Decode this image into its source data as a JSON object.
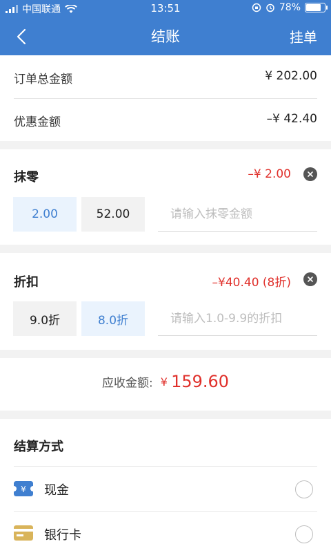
{
  "status_bar": {
    "carrier": "中国联通",
    "time": "13:51",
    "battery": "78%",
    "battery_level": 0.78
  },
  "nav": {
    "title": "结账",
    "action": "挂单"
  },
  "summary": {
    "total_label": "订单总金额",
    "total_value": "¥ 202.00",
    "discount_label": "优惠金额",
    "discount_value": "–¥ 42.40"
  },
  "rounding": {
    "title": "抹零",
    "value": "–¥ 2.00",
    "options": [
      "2.00",
      "52.00"
    ],
    "selected": 0,
    "placeholder": "请输入抹零金额"
  },
  "discount": {
    "title": "折扣",
    "value": "–¥40.40 (8折)",
    "options": [
      "9.0折",
      "8.0折"
    ],
    "selected": 1,
    "placeholder": "请输入1.0-9.9的折扣"
  },
  "receivable": {
    "label": "应收金额:",
    "currency": "¥",
    "value": "159.60"
  },
  "payment": {
    "title": "结算方式",
    "methods": [
      {
        "label": "现金",
        "icon": "cash-icon",
        "color": "#3f7fd0"
      },
      {
        "label": "银行卡",
        "icon": "bank-card-icon",
        "color": "#d9b45a"
      }
    ]
  },
  "colors": {
    "primary": "#3f7fd0",
    "accent_red": "#e0302b"
  }
}
